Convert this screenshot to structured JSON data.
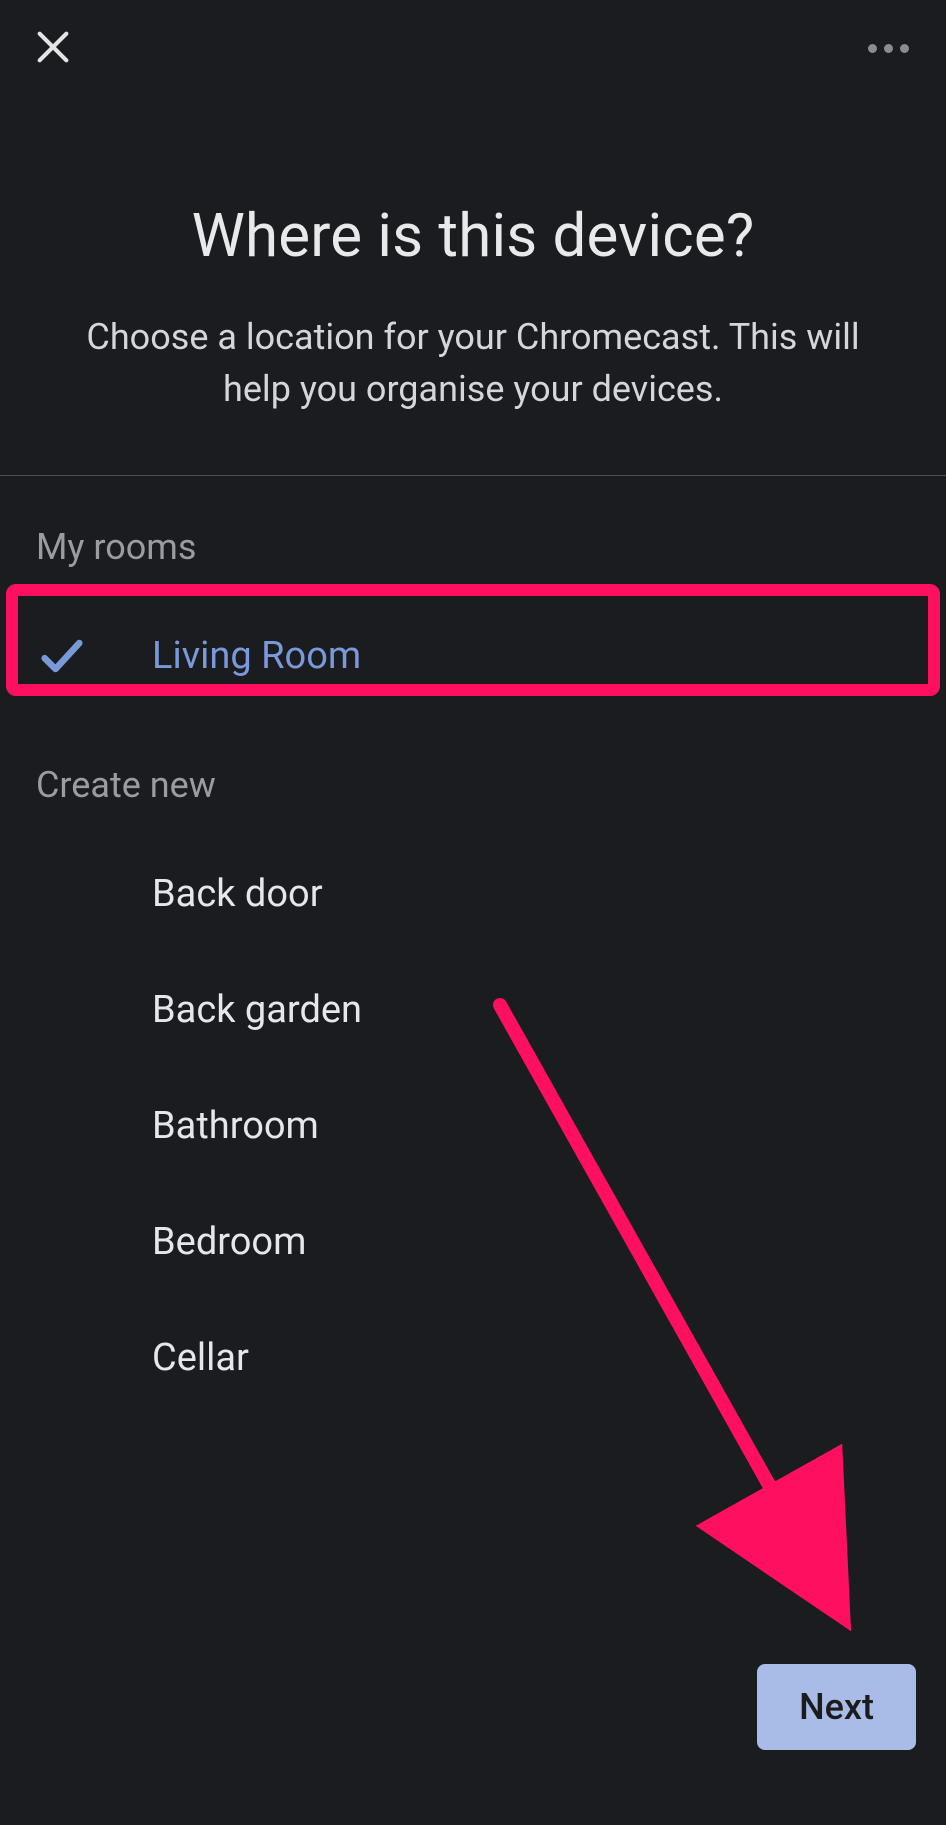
{
  "header": {
    "title": "Where is this device?",
    "subtitle": "Choose a location for your Chromecast. This will help you organise your devices."
  },
  "sections": {
    "my_rooms_label": "My rooms",
    "create_new_label": "Create new"
  },
  "my_rooms": [
    {
      "label": "Living Room",
      "selected": true
    }
  ],
  "create_new": [
    {
      "label": "Back door"
    },
    {
      "label": "Back garden"
    },
    {
      "label": "Bathroom"
    },
    {
      "label": "Bedroom"
    },
    {
      "label": "Cellar"
    }
  ],
  "actions": {
    "next_label": "Next"
  },
  "annotation": {
    "highlighted_room": "Living Room",
    "arrow_target": "Next"
  }
}
